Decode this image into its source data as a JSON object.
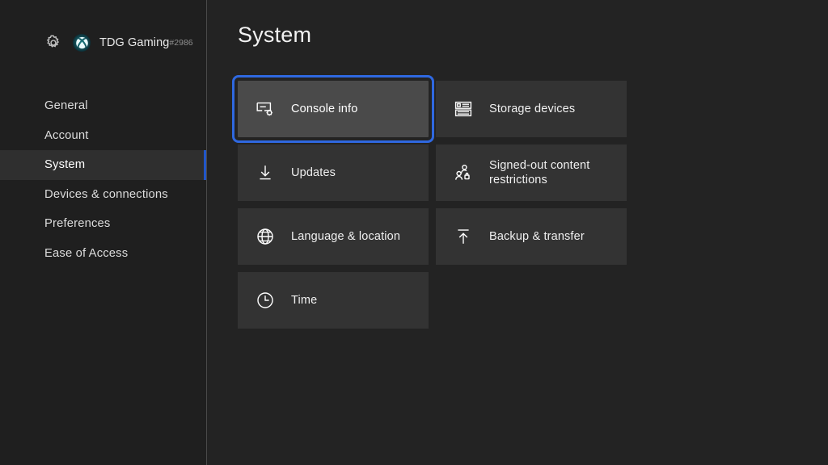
{
  "sidebar": {
    "profile": {
      "gear_icon": "gear-icon",
      "avatar_icon": "xbox-logo-icon",
      "name": "TDG Gaming",
      "tag": "#2986"
    },
    "items": [
      {
        "label": "General",
        "selected": false
      },
      {
        "label": "Account",
        "selected": false
      },
      {
        "label": "System",
        "selected": true
      },
      {
        "label": "Devices & connections",
        "selected": false
      },
      {
        "label": "Preferences",
        "selected": false
      },
      {
        "label": "Ease of Access",
        "selected": false
      }
    ]
  },
  "main": {
    "title": "System",
    "tiles": [
      {
        "label": "Console info",
        "icon": "monitor-gear-icon",
        "focused": true
      },
      {
        "label": "Storage devices",
        "icon": "storage-drives-icon",
        "focused": false
      },
      {
        "label": "Updates",
        "icon": "download-arrow-icon",
        "focused": false
      },
      {
        "label": "Signed-out content restrictions",
        "icon": "people-lock-icon",
        "focused": false,
        "line1": "Signed-out content",
        "line2": "restrictions"
      },
      {
        "label": "Language & location",
        "icon": "globe-icon",
        "focused": false
      },
      {
        "label": "Backup & transfer",
        "icon": "upload-arrow-icon",
        "focused": false
      },
      {
        "label": "Time",
        "icon": "clock-icon",
        "focused": false
      }
    ]
  },
  "colors": {
    "accent_blue": "#2f68e0",
    "selection_bar": "#2156c9",
    "sidebar_bg": "#1f1f1f",
    "main_bg": "#232323",
    "tile_bg": "#333333",
    "tile_focused_bg": "#4a4a4a"
  }
}
